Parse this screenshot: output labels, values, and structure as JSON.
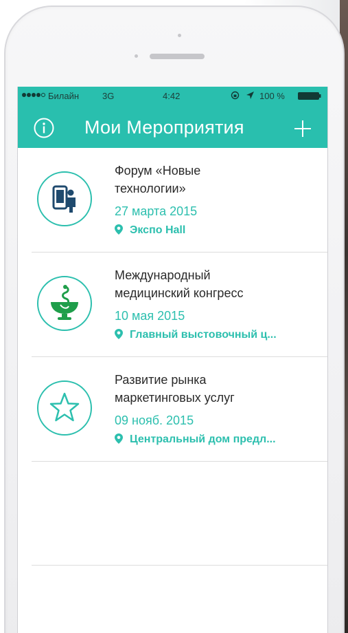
{
  "status_bar": {
    "carrier": "Билайн",
    "network": "3G",
    "time": "4:42",
    "battery": "100 %"
  },
  "header": {
    "title": "Мои Мероприятия",
    "info_icon": "info-icon",
    "add_icon": "plus-icon"
  },
  "colors": {
    "accent": "#29bfae",
    "text": "#2a2a2a",
    "divider": "#dcdcdc"
  },
  "events": [
    {
      "name_line1": "Форум «Новые",
      "name_line2": "технологии»",
      "date": "27 марта 2015",
      "venue": "Экспо Hall",
      "icon": "phone-person-icon"
    },
    {
      "name_line1": "Международный",
      "name_line2": "медицинский конгресс",
      "date": "10 мая 2015",
      "venue": "Главный выстовочный ц...",
      "icon": "medical-bowl-icon"
    },
    {
      "name_line1": "Развитие рынка",
      "name_line2": "маркетинговых услуг",
      "date": "09 нояб. 2015",
      "venue": "Центральный дом предл...",
      "icon": "star-icon"
    }
  ]
}
